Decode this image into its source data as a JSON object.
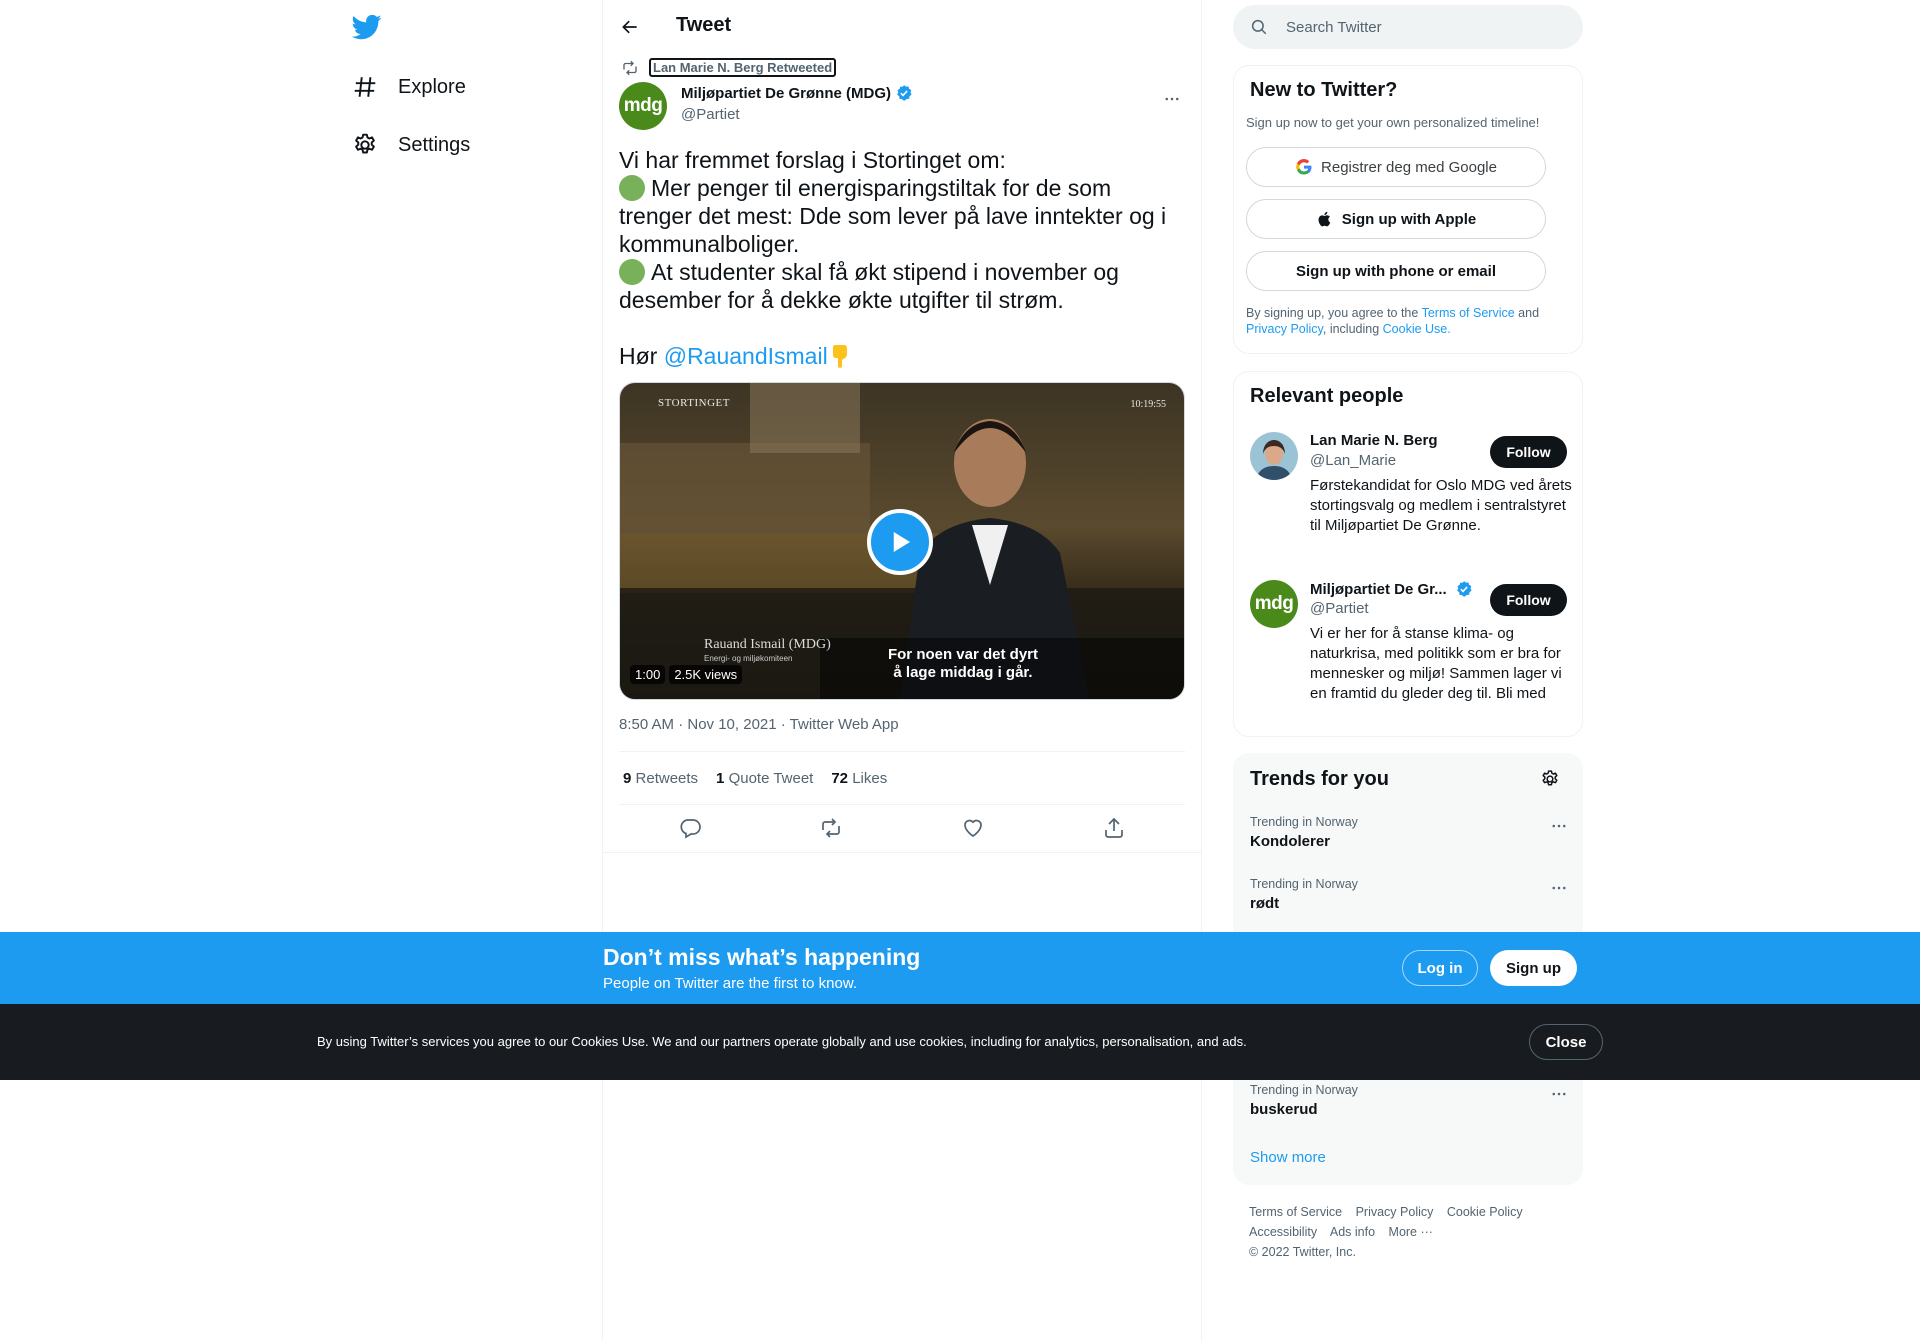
{
  "nav": {
    "logo_icon": "twitter-bird-icon",
    "items": [
      {
        "label": "Explore",
        "icon": "hashtag-icon"
      },
      {
        "label": "Settings",
        "icon": "gear-icon"
      }
    ]
  },
  "header": {
    "title": "Tweet"
  },
  "tweet": {
    "retweeted_by": "Lan Marie N. Berg Retweeted",
    "author_name": "Miljøpartiet De Grønne (MDG)",
    "author_handle": "@Partiet",
    "avatar_text": "mdg",
    "text": {
      "line1": "Vi har fremmet forslag i Stortinget om:",
      "point1": "Mer penger til energisparingstiltak for de som trenger det mest: Dde som lever på lave inntekter og i kommunalboliger.",
      "point2": "At studenter skal få økt stipend i november og desember for å dekke økte utgifter til strøm.",
      "hear": "Hør ",
      "mention": "@RauandIsmail"
    },
    "video": {
      "duration": "1:00",
      "views": "2.5K views",
      "watermark": "STORTINGET",
      "timestamp": "10:19:55",
      "speaker_name": "Rauand Ismail (MDG)",
      "speaker_role": "Energi- og miljøkomiteen",
      "subtitle_line1": "For noen var det dyrt",
      "subtitle_line2": "å lage middag i går."
    },
    "meta": "8:50 AM · Nov 10, 2021 · Twitter Web App",
    "stats": {
      "retweets_count": "9",
      "retweets_label": "Retweets",
      "quotes_count": "1",
      "quotes_label": "Quote Tweet",
      "likes_count": "72",
      "likes_label": "Likes"
    }
  },
  "search": {
    "placeholder": "Search Twitter"
  },
  "new_to_twitter": {
    "title": "New to Twitter?",
    "subtitle": "Sign up now to get your own personalized timeline!",
    "google_label": "Registrer deg med Google",
    "apple_label": "Sign up with Apple",
    "phone_label": "Sign up with phone or email",
    "legal_prefix": "By signing up, you agree to the ",
    "terms_link": "Terms of Service",
    "legal_and": " and ",
    "privacy_link": "Privacy Policy",
    "legal_including": ", including ",
    "cookie_link": "Cookie Use."
  },
  "relevant_people": {
    "title": "Relevant people",
    "people": [
      {
        "name": "Lan Marie N. Berg",
        "handle": "@Lan_Marie",
        "bio": "Førstekandidat for Oslo MDG ved årets stortingsvalg og medlem i sentralstyret til Miljøpartiet De Grønne.",
        "follow_label": "Follow"
      },
      {
        "name": "Miljøpartiet De Gr...",
        "handle": "@Partiet",
        "avatar_text": "mdg",
        "bio": "Vi er her for å stanse klima- og naturkrisa, med politikk som er bra for mennesker og miljø! Sammen lager vi en framtid du gleder deg til. Bli med",
        "follow_label": "Follow"
      }
    ]
  },
  "trends": {
    "title": "Trends for you",
    "items": [
      {
        "context": "Trending in Norway",
        "name": "Kondolerer"
      },
      {
        "context": "Trending in Norway",
        "name": "rødt"
      },
      {
        "context": "Trending in Norway",
        "name": "buskerud"
      }
    ],
    "show_more": "Show more"
  },
  "footer": {
    "links": [
      "Terms of Service",
      "Privacy Policy",
      "Cookie Policy",
      "Accessibility",
      "Ads info",
      "More ···"
    ],
    "copyright": "© 2022 Twitter, Inc."
  },
  "banner": {
    "title": "Don’t miss what’s happening",
    "subtitle": "People on Twitter are the first to know.",
    "login_label": "Log in",
    "signup_label": "Sign up"
  },
  "cookie": {
    "text": "By using Twitter’s services you agree to our Cookies Use. We and our partners operate globally and use cookies, including for analytics, personalisation, and ads.",
    "close_label": "Close"
  },
  "colors": {
    "accent": "#1d9bf0",
    "text": "#0f1419",
    "muted": "#536471",
    "mdg_green": "#4a8a1a"
  }
}
